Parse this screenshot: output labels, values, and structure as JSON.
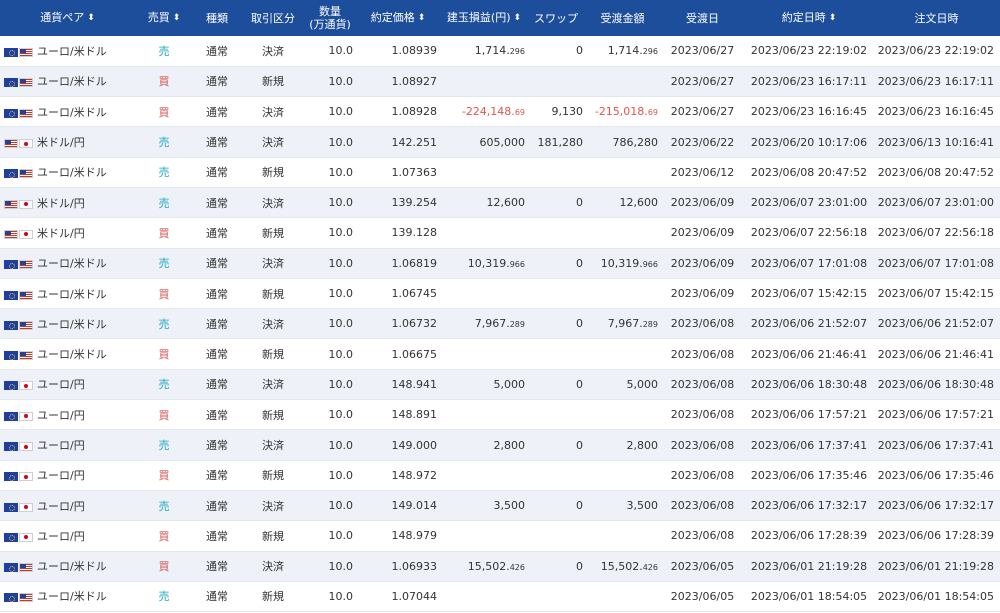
{
  "header": {
    "pair": "通貨ペア",
    "side": "売買",
    "kind": "種類",
    "type": "取引区分",
    "qty_line1": "数量",
    "qty_line2": "(万通貨)",
    "price": "約定価格",
    "pl": "建玉損益(円)",
    "swap": "スワップ",
    "amount": "受渡金額",
    "settle_date": "受渡日",
    "exec_time": "約定日時",
    "order_time": "注文日時"
  },
  "sort_icon": "sort-updown-icon",
  "colors": {
    "header_bg": "#1d4e9b",
    "sell": "#1fa7c4",
    "buy": "#d9534f",
    "negative": "#e0554e",
    "alt_row": "#eef2f8"
  },
  "rows": [
    {
      "flags": [
        "eu",
        "us"
      ],
      "pair": "ユーロ/米ドル",
      "side": "売",
      "side_class": "sell",
      "kind": "通常",
      "type": "決済",
      "qty": "10.0",
      "price": "1.08939",
      "pl_main": "1,714.",
      "pl_small": "296",
      "pl_neg": false,
      "swap": "0",
      "amt_main": "1,714.",
      "amt_small": "296",
      "amt_neg": false,
      "settle": "2023/06/27",
      "exec": "2023/06/23 22:19:02",
      "order": "2023/06/23 22:19:02"
    },
    {
      "flags": [
        "eu",
        "us"
      ],
      "pair": "ユーロ/米ドル",
      "side": "買",
      "side_class": "buy",
      "kind": "通常",
      "type": "新規",
      "qty": "10.0",
      "price": "1.08927",
      "pl_main": "",
      "pl_small": "",
      "pl_neg": false,
      "swap": "",
      "amt_main": "",
      "amt_small": "",
      "amt_neg": false,
      "settle": "2023/06/27",
      "exec": "2023/06/23 16:17:11",
      "order": "2023/06/23 16:17:11"
    },
    {
      "flags": [
        "eu",
        "us"
      ],
      "pair": "ユーロ/米ドル",
      "side": "買",
      "side_class": "buy",
      "kind": "通常",
      "type": "決済",
      "qty": "10.0",
      "price": "1.08928",
      "pl_main": "-224,148.",
      "pl_small": "69",
      "pl_neg": true,
      "swap": "9,130",
      "amt_main": "-215,018.",
      "amt_small": "69",
      "amt_neg": true,
      "settle": "2023/06/27",
      "exec": "2023/06/23 16:16:45",
      "order": "2023/06/23 16:16:45"
    },
    {
      "flags": [
        "us",
        "jp"
      ],
      "pair": "米ドル/円",
      "side": "売",
      "side_class": "sell",
      "kind": "通常",
      "type": "決済",
      "qty": "10.0",
      "price": "142.251",
      "pl_main": "605,000",
      "pl_small": "",
      "pl_neg": false,
      "swap": "181,280",
      "amt_main": "786,280",
      "amt_small": "",
      "amt_neg": false,
      "settle": "2023/06/22",
      "exec": "2023/06/20 10:17:06",
      "order": "2023/06/13 10:16:41"
    },
    {
      "flags": [
        "eu",
        "us"
      ],
      "pair": "ユーロ/米ドル",
      "side": "売",
      "side_class": "sell",
      "kind": "通常",
      "type": "新規",
      "qty": "10.0",
      "price": "1.07363",
      "pl_main": "",
      "pl_small": "",
      "pl_neg": false,
      "swap": "",
      "amt_main": "",
      "amt_small": "",
      "amt_neg": false,
      "settle": "2023/06/12",
      "exec": "2023/06/08 20:47:52",
      "order": "2023/06/08 20:47:52"
    },
    {
      "flags": [
        "us",
        "jp"
      ],
      "pair": "米ドル/円",
      "side": "売",
      "side_class": "sell",
      "kind": "通常",
      "type": "決済",
      "qty": "10.0",
      "price": "139.254",
      "pl_main": "12,600",
      "pl_small": "",
      "pl_neg": false,
      "swap": "0",
      "amt_main": "12,600",
      "amt_small": "",
      "amt_neg": false,
      "settle": "2023/06/09",
      "exec": "2023/06/07 23:01:00",
      "order": "2023/06/07 23:01:00"
    },
    {
      "flags": [
        "us",
        "jp"
      ],
      "pair": "米ドル/円",
      "side": "買",
      "side_class": "buy",
      "kind": "通常",
      "type": "新規",
      "qty": "10.0",
      "price": "139.128",
      "pl_main": "",
      "pl_small": "",
      "pl_neg": false,
      "swap": "",
      "amt_main": "",
      "amt_small": "",
      "amt_neg": false,
      "settle": "2023/06/09",
      "exec": "2023/06/07 22:56:18",
      "order": "2023/06/07 22:56:18"
    },
    {
      "flags": [
        "eu",
        "us"
      ],
      "pair": "ユーロ/米ドル",
      "side": "売",
      "side_class": "sell",
      "kind": "通常",
      "type": "決済",
      "qty": "10.0",
      "price": "1.06819",
      "pl_main": "10,319.",
      "pl_small": "966",
      "pl_neg": false,
      "swap": "0",
      "amt_main": "10,319.",
      "amt_small": "966",
      "amt_neg": false,
      "settle": "2023/06/09",
      "exec": "2023/06/07 17:01:08",
      "order": "2023/06/07 17:01:08"
    },
    {
      "flags": [
        "eu",
        "us"
      ],
      "pair": "ユーロ/米ドル",
      "side": "買",
      "side_class": "buy",
      "kind": "通常",
      "type": "新規",
      "qty": "10.0",
      "price": "1.06745",
      "pl_main": "",
      "pl_small": "",
      "pl_neg": false,
      "swap": "",
      "amt_main": "",
      "amt_small": "",
      "amt_neg": false,
      "settle": "2023/06/09",
      "exec": "2023/06/07 15:42:15",
      "order": "2023/06/07 15:42:15"
    },
    {
      "flags": [
        "eu",
        "us"
      ],
      "pair": "ユーロ/米ドル",
      "side": "売",
      "side_class": "sell",
      "kind": "通常",
      "type": "決済",
      "qty": "10.0",
      "price": "1.06732",
      "pl_main": "7,967.",
      "pl_small": "289",
      "pl_neg": false,
      "swap": "0",
      "amt_main": "7,967.",
      "amt_small": "289",
      "amt_neg": false,
      "settle": "2023/06/08",
      "exec": "2023/06/06 21:52:07",
      "order": "2023/06/06 21:52:07"
    },
    {
      "flags": [
        "eu",
        "us"
      ],
      "pair": "ユーロ/米ドル",
      "side": "買",
      "side_class": "buy",
      "kind": "通常",
      "type": "新規",
      "qty": "10.0",
      "price": "1.06675",
      "pl_main": "",
      "pl_small": "",
      "pl_neg": false,
      "swap": "",
      "amt_main": "",
      "amt_small": "",
      "amt_neg": false,
      "settle": "2023/06/08",
      "exec": "2023/06/06 21:46:41",
      "order": "2023/06/06 21:46:41"
    },
    {
      "flags": [
        "eu",
        "jp"
      ],
      "pair": "ユーロ/円",
      "side": "売",
      "side_class": "sell",
      "kind": "通常",
      "type": "決済",
      "qty": "10.0",
      "price": "148.941",
      "pl_main": "5,000",
      "pl_small": "",
      "pl_neg": false,
      "swap": "0",
      "amt_main": "5,000",
      "amt_small": "",
      "amt_neg": false,
      "settle": "2023/06/08",
      "exec": "2023/06/06 18:30:48",
      "order": "2023/06/06 18:30:48"
    },
    {
      "flags": [
        "eu",
        "jp"
      ],
      "pair": "ユーロ/円",
      "side": "買",
      "side_class": "buy",
      "kind": "通常",
      "type": "新規",
      "qty": "10.0",
      "price": "148.891",
      "pl_main": "",
      "pl_small": "",
      "pl_neg": false,
      "swap": "",
      "amt_main": "",
      "amt_small": "",
      "amt_neg": false,
      "settle": "2023/06/08",
      "exec": "2023/06/06 17:57:21",
      "order": "2023/06/06 17:57:21"
    },
    {
      "flags": [
        "eu",
        "jp"
      ],
      "pair": "ユーロ/円",
      "side": "売",
      "side_class": "sell",
      "kind": "通常",
      "type": "決済",
      "qty": "10.0",
      "price": "149.000",
      "pl_main": "2,800",
      "pl_small": "",
      "pl_neg": false,
      "swap": "0",
      "amt_main": "2,800",
      "amt_small": "",
      "amt_neg": false,
      "settle": "2023/06/08",
      "exec": "2023/06/06 17:37:41",
      "order": "2023/06/06 17:37:41"
    },
    {
      "flags": [
        "eu",
        "jp"
      ],
      "pair": "ユーロ/円",
      "side": "買",
      "side_class": "buy",
      "kind": "通常",
      "type": "新規",
      "qty": "10.0",
      "price": "148.972",
      "pl_main": "",
      "pl_small": "",
      "pl_neg": false,
      "swap": "",
      "amt_main": "",
      "amt_small": "",
      "amt_neg": false,
      "settle": "2023/06/08",
      "exec": "2023/06/06 17:35:46",
      "order": "2023/06/06 17:35:46"
    },
    {
      "flags": [
        "eu",
        "jp"
      ],
      "pair": "ユーロ/円",
      "side": "売",
      "side_class": "sell",
      "kind": "通常",
      "type": "決済",
      "qty": "10.0",
      "price": "149.014",
      "pl_main": "3,500",
      "pl_small": "",
      "pl_neg": false,
      "swap": "0",
      "amt_main": "3,500",
      "amt_small": "",
      "amt_neg": false,
      "settle": "2023/06/08",
      "exec": "2023/06/06 17:32:17",
      "order": "2023/06/06 17:32:17"
    },
    {
      "flags": [
        "eu",
        "jp"
      ],
      "pair": "ユーロ/円",
      "side": "買",
      "side_class": "buy",
      "kind": "通常",
      "type": "新規",
      "qty": "10.0",
      "price": "148.979",
      "pl_main": "",
      "pl_small": "",
      "pl_neg": false,
      "swap": "",
      "amt_main": "",
      "amt_small": "",
      "amt_neg": false,
      "settle": "2023/06/08",
      "exec": "2023/06/06 17:28:39",
      "order": "2023/06/06 17:28:39"
    },
    {
      "flags": [
        "eu",
        "us"
      ],
      "pair": "ユーロ/米ドル",
      "side": "買",
      "side_class": "buy",
      "kind": "通常",
      "type": "決済",
      "qty": "10.0",
      "price": "1.06933",
      "pl_main": "15,502.",
      "pl_small": "426",
      "pl_neg": false,
      "swap": "0",
      "amt_main": "15,502.",
      "amt_small": "426",
      "amt_neg": false,
      "settle": "2023/06/05",
      "exec": "2023/06/01 21:19:28",
      "order": "2023/06/01 21:19:28"
    },
    {
      "flags": [
        "eu",
        "us"
      ],
      "pair": "ユーロ/米ドル",
      "side": "売",
      "side_class": "sell",
      "kind": "通常",
      "type": "新規",
      "qty": "10.0",
      "price": "1.07044",
      "pl_main": "",
      "pl_small": "",
      "pl_neg": false,
      "swap": "",
      "amt_main": "",
      "amt_small": "",
      "amt_neg": false,
      "settle": "2023/06/05",
      "exec": "2023/06/01 18:54:05",
      "order": "2023/06/01 18:54:05"
    }
  ]
}
